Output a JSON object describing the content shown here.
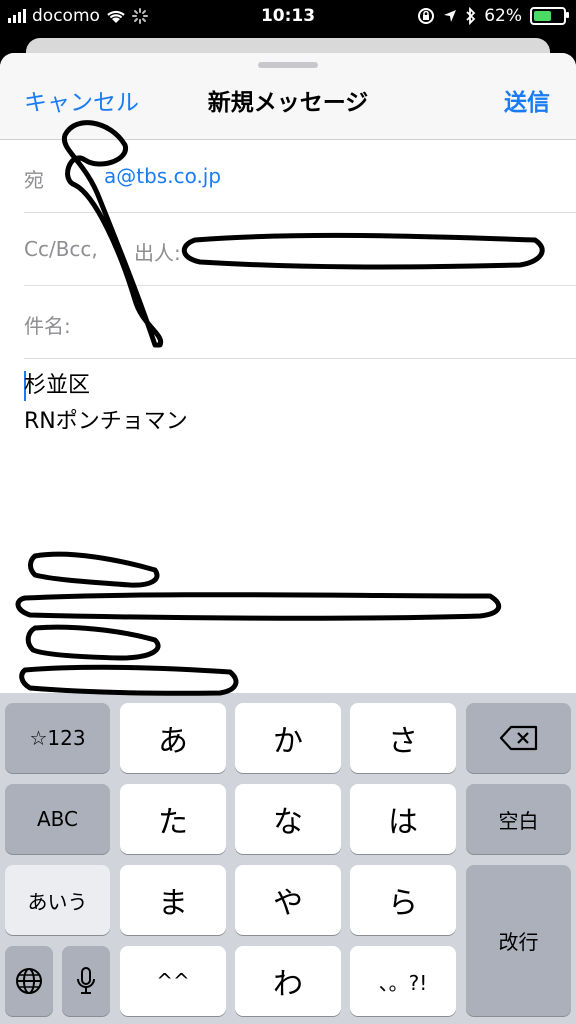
{
  "status_bar": {
    "carrier": "docomo",
    "time": "10:13",
    "battery_percent": "62%",
    "battery_level": 0.62
  },
  "compose": {
    "cancel_label": "キャンセル",
    "title": "新規メッセージ",
    "send_label": "送信",
    "to_label": "宛",
    "to_value": "a@tbs.co.jp",
    "cc_label": "Cc/Bcc,",
    "cc_suffix": "出人:",
    "subject_label": "件名:",
    "body_lines": [
      "杉並区",
      "RNポンチョマン"
    ]
  },
  "keyboard": {
    "row1": [
      "☆123",
      "あ",
      "か",
      "さ"
    ],
    "row2": [
      "ABC",
      "た",
      "な",
      "は",
      "空白"
    ],
    "row3": [
      "あいう",
      "ま",
      "や",
      "ら",
      "改行"
    ],
    "row4": [
      "^^",
      "わ",
      "、。?!"
    ]
  },
  "icons": {
    "wifi": "wifi-icon",
    "loading": "activity-spinner-icon",
    "rotation_lock": "rotation-lock-icon",
    "location": "location-arrow-icon",
    "bluetooth": "bluetooth-icon",
    "backspace": "backspace-icon",
    "globe": "globe-icon",
    "mic": "microphone-icon"
  },
  "colors": {
    "accent": "#1a7cf5",
    "battery": "#4cd964"
  }
}
